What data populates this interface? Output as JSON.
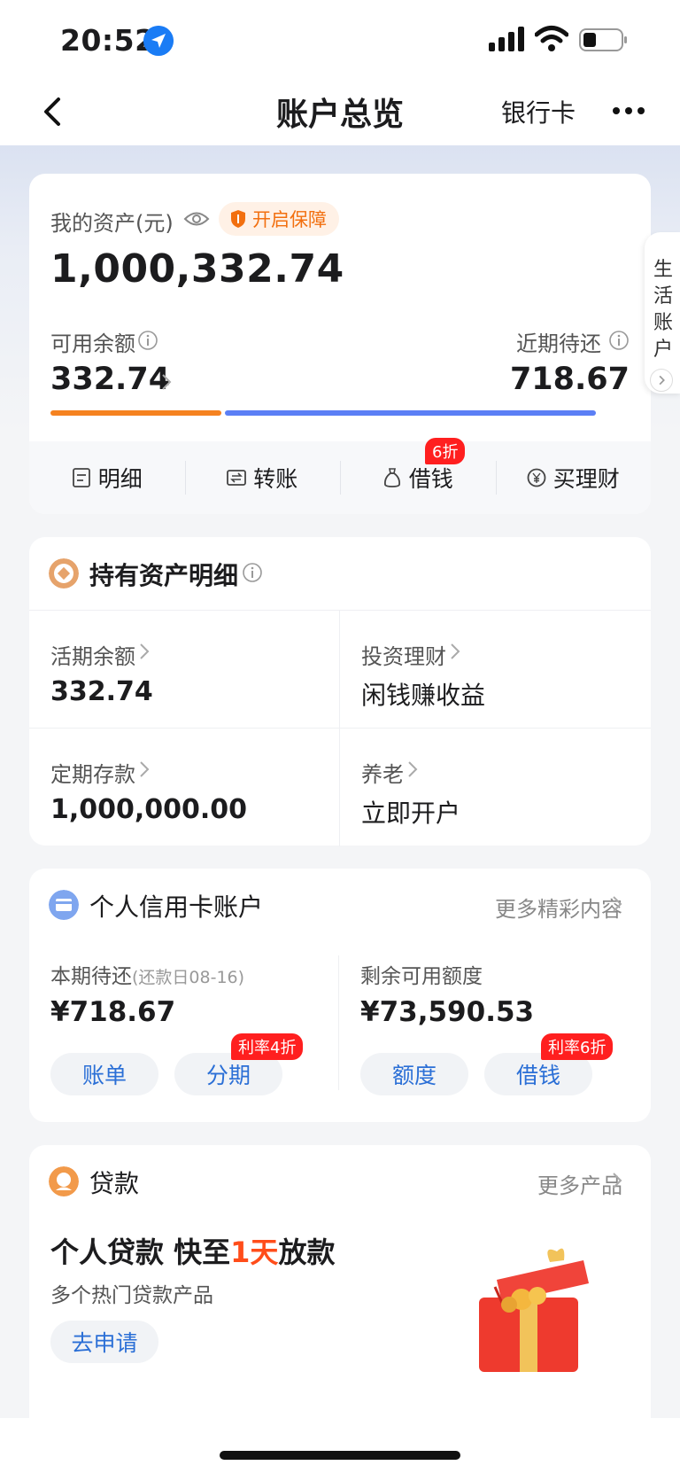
{
  "status_bar": {
    "time": "20:52"
  },
  "nav": {
    "title": "账户总览",
    "bank_card": "银行卡"
  },
  "assets": {
    "label": "我的资产(元)",
    "protect": "开启保障",
    "total": "1,000,332.74",
    "available_label": "可用余额",
    "available_value": "332.74",
    "due_label": "近期待还",
    "due_value": "718.67",
    "actions": [
      {
        "label": "明细",
        "icon": "list-icon"
      },
      {
        "label": "转账",
        "icon": "transfer-icon"
      },
      {
        "label": "借钱",
        "icon": "money-bag-icon",
        "badge": "6折"
      },
      {
        "label": "买理财",
        "icon": "yuan-circle-icon"
      }
    ],
    "bar_colors": {
      "available": "#f58220",
      "due": "#5b7ff5"
    }
  },
  "side_tab": {
    "text": "生活账户"
  },
  "holdings": {
    "title": "持有资产明细",
    "cells": [
      {
        "label": "活期余额",
        "value": "332.74"
      },
      {
        "label": "投资理财",
        "value": "闲钱赚收益"
      },
      {
        "label": "定期存款",
        "value": "1,000,000.00"
      },
      {
        "label": "养老",
        "value": "立即开户"
      }
    ]
  },
  "credit": {
    "title": "个人信用卡账户",
    "more": "更多精彩内容",
    "due_label": "本期待还",
    "due_note": "(还款日08-16)",
    "due_value": "¥718.67",
    "limit_label": "剩余可用额度",
    "limit_value": "¥73,590.53",
    "buttons": [
      {
        "label": "账单"
      },
      {
        "label": "分期",
        "badge": "利率4折"
      },
      {
        "label": "额度"
      },
      {
        "label": "借钱",
        "badge": "利率6折"
      }
    ]
  },
  "loan": {
    "title": "贷款",
    "more": "更多产品",
    "headline_pre": "个人贷款 快至",
    "headline_hi": "1天",
    "headline_post": "放款",
    "sub": "多个热门贷款产品",
    "apply": "去申请"
  },
  "colors": {
    "accent_orange": "#f26f0f",
    "link_blue": "#2b6fd6",
    "badge_red": "#ff1f1f"
  }
}
